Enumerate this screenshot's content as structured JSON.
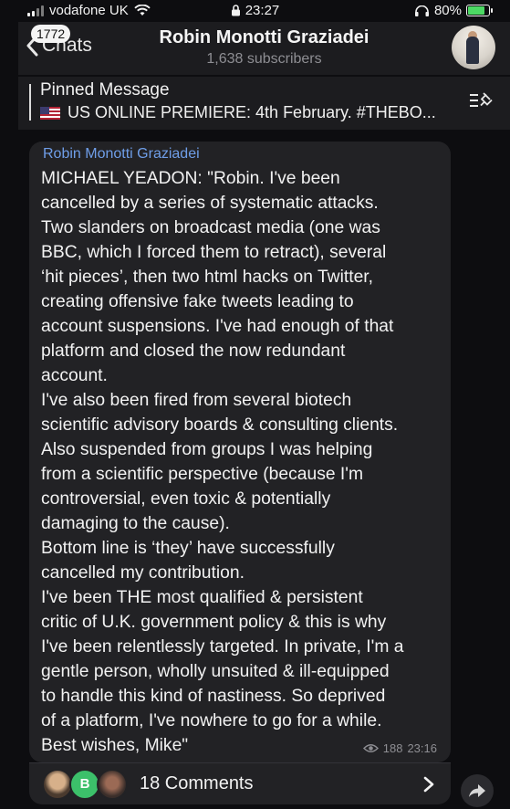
{
  "status_bar": {
    "carrier": "vodafone UK",
    "time": "23:27",
    "battery": "80%"
  },
  "header": {
    "back_label": "Chats",
    "unread_badge": "1772",
    "title": "Robin Monotti Graziadei",
    "subscribers": "1,638 subscribers"
  },
  "pinned": {
    "label": "Pinned Message",
    "text": "US ONLINE  PREMIERE: 4th February. #THEBO..."
  },
  "message": {
    "sender": "Robin Monotti Graziadei",
    "lines": [
      "MICHAEL YEADON: \"Robin. I've been",
      "cancelled by a series of systematic attacks.",
      "Two slanders on broadcast media (one was",
      "BBC, which I forced them to retract), several",
      "‘hit pieces’, then two html hacks on Twitter,",
      "creating offensive fake tweets leading to",
      "account suspensions. I've had enough of that",
      "platform and closed the now redundant",
      "account.",
      "I've also been fired from several biotech",
      "scientific advisory boards & consulting clients.",
      "Also suspended from groups I was helping",
      "from a scientific perspective (because I'm",
      "controversial, even toxic & potentially",
      "damaging to the cause).",
      "Bottom line is ‘they’ have successfully",
      "cancelled my contribution.",
      "I've been THE most qualified & persistent",
      "critic of U.K. government policy & this is why",
      "I've been relentlessly targeted. In private, I'm a",
      "gentle person, wholly unsuited & ill-equipped",
      "to handle this kind of nastiness. So deprived",
      "of a platform, I've nowhere to go for a while.",
      "Best wishes, Mike\""
    ],
    "views": "188",
    "time": "23:16"
  },
  "comments": {
    "label": "18 Comments",
    "avatar_initial": "B"
  },
  "colors": {
    "accent_name": "#6f9ee8",
    "bubble": "#222225",
    "header": "#1c1c1f"
  }
}
